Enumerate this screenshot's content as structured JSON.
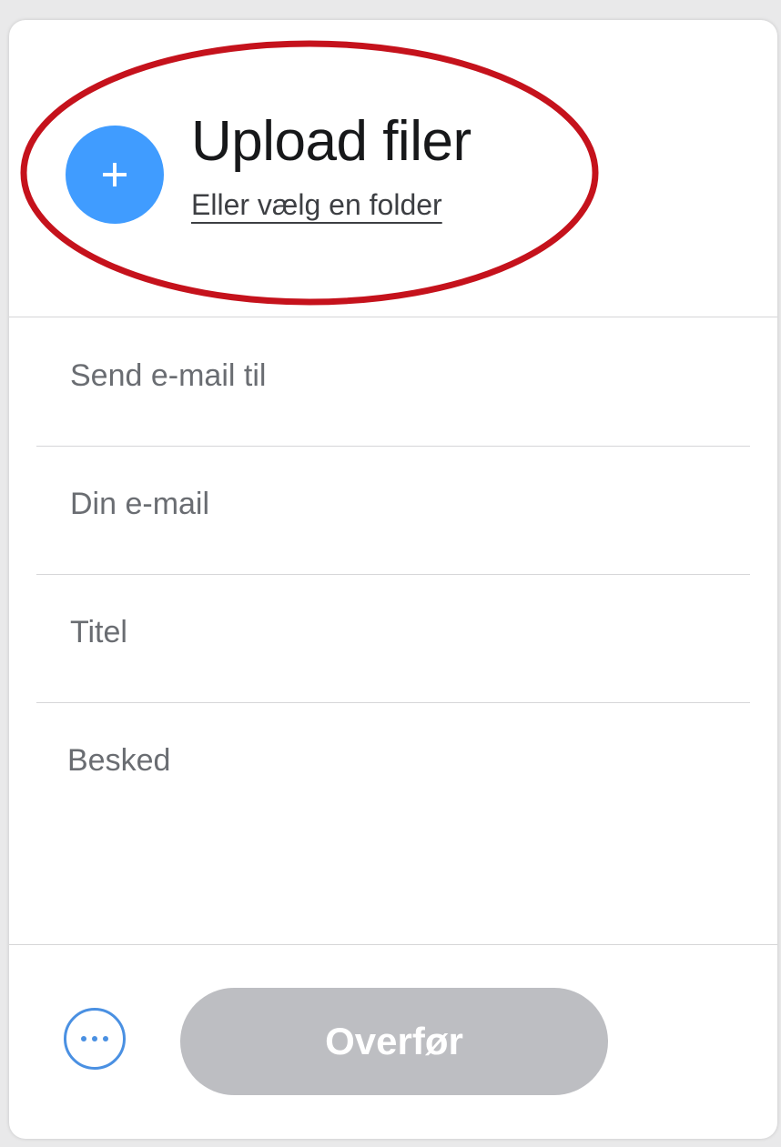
{
  "upload": {
    "title": "Upload filer",
    "folder_link": "Eller vælg en folder",
    "add_icon": "plus-icon",
    "accent_color": "#409cff"
  },
  "form": {
    "send_to_placeholder": "Send e-mail til",
    "your_email_placeholder": "Din e-mail",
    "title_placeholder": "Titel",
    "message_placeholder": "Besked"
  },
  "footer": {
    "more_icon": "more-options-icon",
    "transfer_label": "Overfør",
    "transfer_color": "#bdbec2"
  },
  "annotation": {
    "color": "#c5121c",
    "shape": "ellipse"
  }
}
